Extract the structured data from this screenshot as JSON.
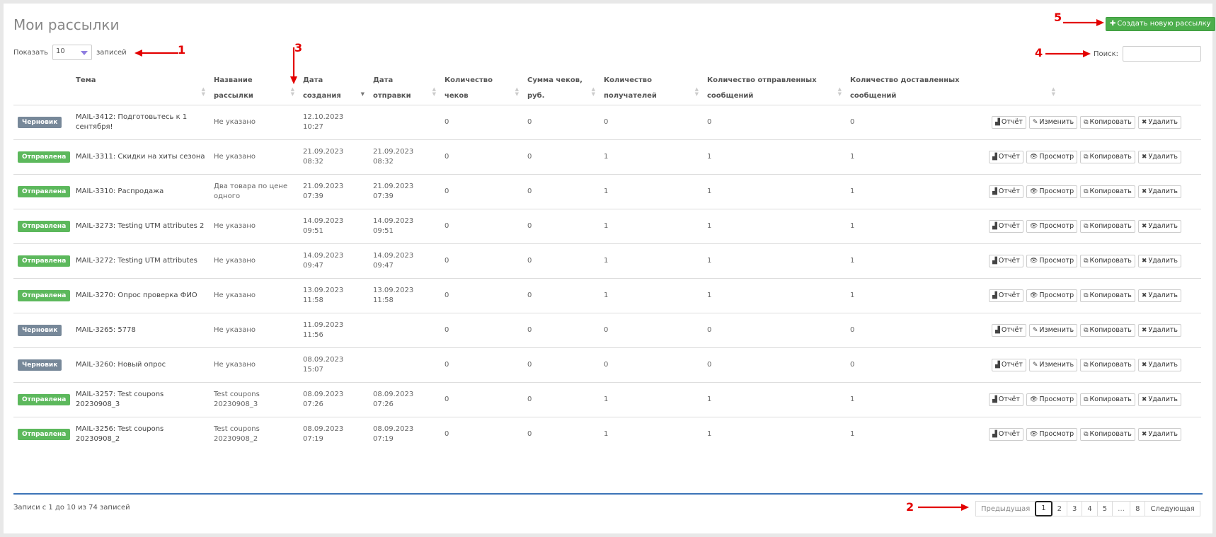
{
  "page": {
    "title": "Мои рассылки",
    "create_button": "Создать новую рассылку"
  },
  "length": {
    "show_label": "Показать",
    "value": "10",
    "records_label": "записей"
  },
  "search": {
    "label": "Поиск:",
    "value": ""
  },
  "columns": [
    "Тема",
    "Название рассылки",
    "Дата создания",
    "Дата отправки",
    "Количество чеков",
    "Сумма чеков, руб.",
    "Количество получателей",
    "Количество отправленных сообщений",
    "Количество доставленных сообщений"
  ],
  "header_lines": [
    [
      "Тема",
      ""
    ],
    [
      "Название",
      "рассылки"
    ],
    [
      "Дата",
      "создания"
    ],
    [
      "Дата",
      "отправки"
    ],
    [
      "Количество",
      "чеков"
    ],
    [
      "Сумма чеков,",
      "руб."
    ],
    [
      "Количество",
      "получателей"
    ],
    [
      "Количество отправленных",
      "сообщений"
    ],
    [
      "Количество доставленных",
      "сообщений"
    ]
  ],
  "rows": [
    {
      "status": "Черновик",
      "status_type": "draft",
      "subject": "MAIL-3412: Подготовьтесь к 1 сентября!",
      "name": "Не указано",
      "created": "12.10.2023 10:27",
      "sent": "",
      "checks": "0",
      "sum": "0",
      "recipients": "0",
      "sent_msgs": "0",
      "delivered": "0",
      "edit_label": "Изменить"
    },
    {
      "status": "Отправлена",
      "status_type": "sent",
      "subject": "MAIL-3311: Скидки на хиты сезона",
      "name": "Не указано",
      "created": "21.09.2023 08:32",
      "sent": "21.09.2023 08:32",
      "checks": "0",
      "sum": "0",
      "recipients": "1",
      "sent_msgs": "1",
      "delivered": "1",
      "edit_label": "Просмотр"
    },
    {
      "status": "Отправлена",
      "status_type": "sent",
      "subject": "MAIL-3310: Распродажа",
      "name": "Два товара по цене одного",
      "created": "21.09.2023 07:39",
      "sent": "21.09.2023 07:39",
      "checks": "0",
      "sum": "0",
      "recipients": "1",
      "sent_msgs": "1",
      "delivered": "1",
      "edit_label": "Просмотр"
    },
    {
      "status": "Отправлена",
      "status_type": "sent",
      "subject": "MAIL-3273: Testing UTM attributes 2",
      "name": "Не указано",
      "created": "14.09.2023 09:51",
      "sent": "14.09.2023 09:51",
      "checks": "0",
      "sum": "0",
      "recipients": "1",
      "sent_msgs": "1",
      "delivered": "1",
      "edit_label": "Просмотр"
    },
    {
      "status": "Отправлена",
      "status_type": "sent",
      "subject": "MAIL-3272: Testing UTM attributes",
      "name": "Не указано",
      "created": "14.09.2023 09:47",
      "sent": "14.09.2023 09:47",
      "checks": "0",
      "sum": "0",
      "recipients": "1",
      "sent_msgs": "1",
      "delivered": "1",
      "edit_label": "Просмотр"
    },
    {
      "status": "Отправлена",
      "status_type": "sent",
      "subject": "MAIL-3270: Опрос проверка ФИО",
      "name": "Не указано",
      "created": "13.09.2023 11:58",
      "sent": "13.09.2023 11:58",
      "checks": "0",
      "sum": "0",
      "recipients": "1",
      "sent_msgs": "1",
      "delivered": "1",
      "edit_label": "Просмотр"
    },
    {
      "status": "Черновик",
      "status_type": "draft",
      "subject": "MAIL-3265: 5778",
      "name": "Не указано",
      "created": "11.09.2023 11:56",
      "sent": "",
      "checks": "0",
      "sum": "0",
      "recipients": "0",
      "sent_msgs": "0",
      "delivered": "0",
      "edit_label": "Изменить"
    },
    {
      "status": "Черновик",
      "status_type": "draft",
      "subject": "MAIL-3260: Новый опрос",
      "name": "Не указано",
      "created": "08.09.2023 15:07",
      "sent": "",
      "checks": "0",
      "sum": "0",
      "recipients": "0",
      "sent_msgs": "0",
      "delivered": "0",
      "edit_label": "Изменить"
    },
    {
      "status": "Отправлена",
      "status_type": "sent",
      "subject": "MAIL-3257: Test coupons 20230908_3",
      "name": "Test coupons 20230908_3",
      "created": "08.09.2023 07:26",
      "sent": "08.09.2023 07:26",
      "checks": "0",
      "sum": "0",
      "recipients": "1",
      "sent_msgs": "1",
      "delivered": "1",
      "edit_label": "Просмотр"
    },
    {
      "status": "Отправлена",
      "status_type": "sent",
      "subject": "MAIL-3256: Test coupons 20230908_2",
      "name": "Test coupons 20230908_2",
      "created": "08.09.2023 07:19",
      "sent": "08.09.2023 07:19",
      "checks": "0",
      "sum": "0",
      "recipients": "1",
      "sent_msgs": "1",
      "delivered": "1",
      "edit_label": "Просмотр"
    }
  ],
  "row_actions": {
    "report": "Отчёт",
    "copy": "Копировать",
    "delete": "Удалить"
  },
  "footer": {
    "info": "Записи с 1 до 10 из 74 записей"
  },
  "pagination": {
    "prev": "Предыдущая",
    "pages": [
      "1",
      "2",
      "3",
      "4",
      "5",
      "…",
      "8"
    ],
    "current": "1",
    "next": "Следующая"
  },
  "annotations": [
    "1",
    "2",
    "3",
    "4",
    "5"
  ],
  "colors": {
    "draft_badge": "#778899",
    "sent_badge": "#5cb85c",
    "create_button": "#4cae4c",
    "annotation": "#e30000",
    "table_bottom_line": "#3d74b8"
  }
}
